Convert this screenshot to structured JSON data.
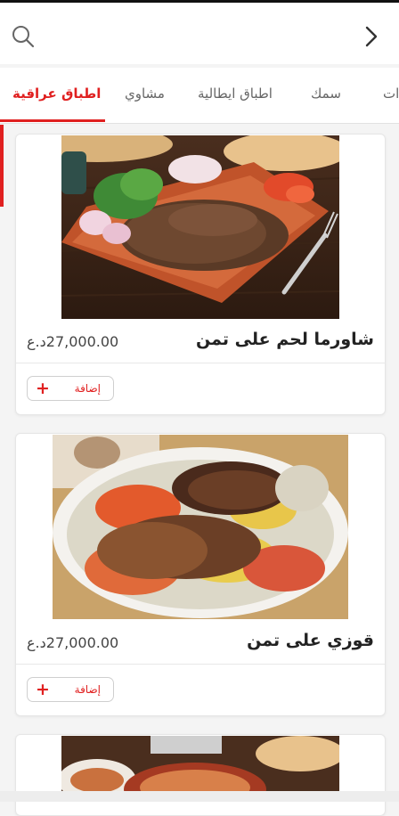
{
  "tabs": [
    {
      "label": "اطباق عراقية"
    },
    {
      "label": "مشاوي"
    },
    {
      "label": "اطباق ايطالية"
    },
    {
      "label": "سمك"
    },
    {
      "label": "ات"
    }
  ],
  "items": [
    {
      "name": "شاورما لحم على تمن",
      "price": "27,000.00د.ع",
      "add_label": "إضافة"
    },
    {
      "name": "قوزي على تمن",
      "price": "27,000.00د.ع",
      "add_label": "إضافة"
    }
  ],
  "colors": {
    "accent": "#e02020"
  },
  "icons": {
    "search": "search-icon",
    "back": "chevron-right-icon",
    "add": "plus-icon"
  }
}
